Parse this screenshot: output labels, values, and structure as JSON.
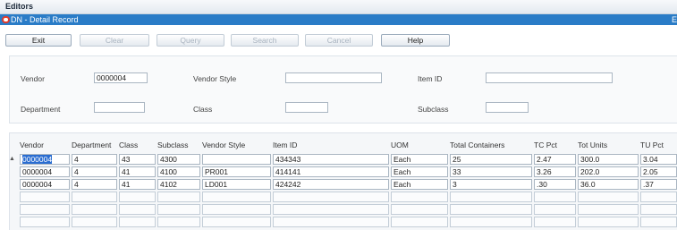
{
  "tabbar": {
    "tab_label": "Editors"
  },
  "titlebar": {
    "title": "DN - Detail Record",
    "edge_glyph": "E"
  },
  "toolbar": {
    "buttons": [
      {
        "label": "Exit",
        "enabled": true
      },
      {
        "label": "Clear",
        "enabled": false
      },
      {
        "label": "Query",
        "enabled": false
      },
      {
        "label": "Search",
        "enabled": false
      },
      {
        "label": "Cancel",
        "enabled": false
      },
      {
        "label": "Help",
        "enabled": true
      }
    ]
  },
  "form": {
    "vendor_label": "Vendor",
    "vendor_value": "0000004",
    "vendor_style_label": "Vendor Style",
    "vendor_style_value": "",
    "item_id_label": "Item ID",
    "item_id_value": "",
    "department_label": "Department",
    "department_value": "",
    "class_label": "Class",
    "class_value": "",
    "subclass_label": "Subclass",
    "subclass_value": ""
  },
  "grid": {
    "row_indicator": "▲",
    "columns": [
      "Vendor",
      "Department",
      "Class",
      "Subclass",
      "Vendor Style",
      "Item ID",
      "UOM",
      "Total Containers",
      "TC Pct",
      "Tot Units",
      "TU Pct"
    ],
    "rows": [
      [
        "0000004",
        "4",
        "43",
        "4300",
        "",
        "434343",
        "Each",
        "25",
        "2.47",
        "300.0",
        "3.04"
      ],
      [
        "0000004",
        "4",
        "41",
        "4100",
        "PR001",
        "414141",
        "Each",
        "33",
        "3.26",
        "202.0",
        "2.05"
      ],
      [
        "0000004",
        "4",
        "41",
        "4102",
        "LD001",
        "424242",
        "Each",
        "3",
        ".30",
        "36.0",
        ".37"
      ]
    ],
    "empty_rows": 3
  },
  "colors": {
    "title_bar": "#2a7cc7",
    "selection": "#2a6dd1",
    "close_dot": "#e03b2b"
  }
}
